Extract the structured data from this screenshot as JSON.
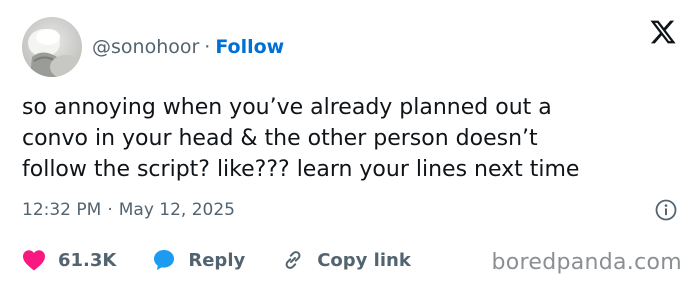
{
  "author": {
    "handle": "@sonohoor",
    "separator": "·",
    "follow_label": "Follow"
  },
  "icons": {
    "avatar": "avatar-image",
    "logo": "x-logo-icon",
    "info": "info-icon",
    "like": "heart-icon",
    "reply": "speech-bubble-icon",
    "copy": "link-icon"
  },
  "colors": {
    "follow": "#006fd6",
    "like": "#f91880",
    "reply": "#1d9bf0",
    "text": "#0f1419",
    "muted": "#536471"
  },
  "tweet": {
    "text": "so annoying when you’ve already planned out a\nconvo in your head & the other person doesn’t\nfollow the script? like??? learn your lines next time"
  },
  "timestamp": {
    "time": "12:32 PM",
    "separator": "·",
    "date": "May 12, 2025"
  },
  "actions": {
    "likes": "61.3K",
    "reply_label": "Reply",
    "copy_label": "Copy link"
  },
  "watermark": "boredpanda.com"
}
